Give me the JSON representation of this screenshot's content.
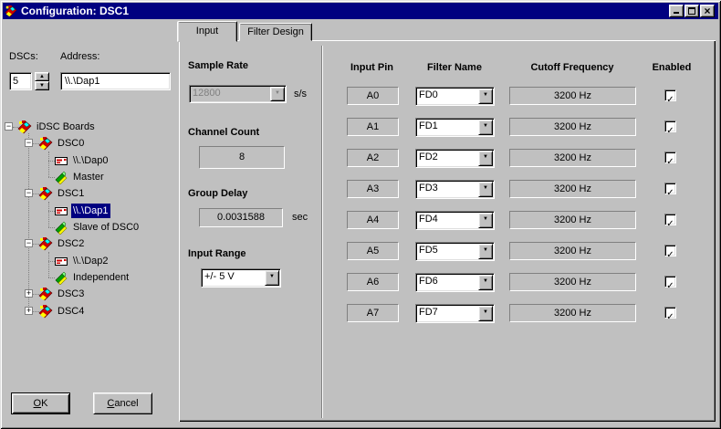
{
  "window": {
    "title": "Configuration: DSC1"
  },
  "icons": {
    "dropdown_arrow": "▼",
    "spinner_up": "▲",
    "spinner_down": "▼",
    "checkbox_check": "✓",
    "expander_expanded": "−",
    "expander_collapsed": "+",
    "close": "×"
  },
  "left_panel": {
    "dscs_label": "DSCs:",
    "dscs_value": "5",
    "address_label": "Address:",
    "address_value": "\\\\.\\Dap1"
  },
  "tree": {
    "items": [
      {
        "label": "iDSC Boards",
        "level": 0,
        "expander": "expanded",
        "icon": "board-icon",
        "selected": false
      },
      {
        "label": "DSC0",
        "level": 1,
        "expander": "expanded",
        "icon": "board-icon",
        "selected": false
      },
      {
        "label": "\\\\.\\Dap0",
        "level": 2,
        "expander": "none",
        "icon": "dap-icon",
        "selected": false
      },
      {
        "label": "Master",
        "level": 2,
        "expander": "none",
        "icon": "mode-icon",
        "selected": false
      },
      {
        "label": "DSC1",
        "level": 1,
        "expander": "expanded",
        "icon": "board-icon",
        "selected": false
      },
      {
        "label": "\\\\.\\Dap1",
        "level": 2,
        "expander": "none",
        "icon": "dap-icon",
        "selected": true
      },
      {
        "label": "Slave of DSC0",
        "level": 2,
        "expander": "none",
        "icon": "mode-icon",
        "selected": false
      },
      {
        "label": "DSC2",
        "level": 1,
        "expander": "expanded",
        "icon": "board-icon",
        "selected": false
      },
      {
        "label": "\\\\.\\Dap2",
        "level": 2,
        "expander": "none",
        "icon": "dap-icon",
        "selected": false
      },
      {
        "label": "Independent",
        "level": 2,
        "expander": "none",
        "icon": "mode-icon",
        "selected": false
      },
      {
        "label": "DSC3",
        "level": 1,
        "expander": "collapsed",
        "icon": "board-icon",
        "selected": false
      },
      {
        "label": "DSC4",
        "level": 1,
        "expander": "collapsed",
        "icon": "board-icon",
        "selected": false
      }
    ]
  },
  "buttons": {
    "ok": {
      "first": "O",
      "rest": "K"
    },
    "cancel": {
      "first": "C",
      "rest": "ancel"
    }
  },
  "tabs": [
    {
      "label": "Input",
      "active": true
    },
    {
      "label": "Filter Design",
      "active": false
    }
  ],
  "settings": {
    "sample_rate": {
      "label": "Sample Rate",
      "value": "12800",
      "unit": "s/s",
      "enabled": false
    },
    "channel_count": {
      "label": "Channel Count",
      "value": "8"
    },
    "group_delay": {
      "label": "Group Delay",
      "value": "0.0031588",
      "unit": "sec"
    },
    "input_range": {
      "label": "Input Range",
      "value": "+/- 5 V"
    }
  },
  "channel_table": {
    "headers": {
      "pin": "Input Pin",
      "filter": "Filter Name",
      "cutoff": "Cutoff Frequency",
      "enabled": "Enabled"
    },
    "rows": [
      {
        "pin": "A0",
        "filter": "FD0",
        "cutoff": "3200 Hz",
        "enabled": true
      },
      {
        "pin": "A1",
        "filter": "FD1",
        "cutoff": "3200 Hz",
        "enabled": true
      },
      {
        "pin": "A2",
        "filter": "FD2",
        "cutoff": "3200 Hz",
        "enabled": true
      },
      {
        "pin": "A3",
        "filter": "FD3",
        "cutoff": "3200 Hz",
        "enabled": true
      },
      {
        "pin": "A4",
        "filter": "FD4",
        "cutoff": "3200 Hz",
        "enabled": true
      },
      {
        "pin": "A5",
        "filter": "FD5",
        "cutoff": "3200 Hz",
        "enabled": true
      },
      {
        "pin": "A6",
        "filter": "FD6",
        "cutoff": "3200 Hz",
        "enabled": true
      },
      {
        "pin": "A7",
        "filter": "FD7",
        "cutoff": "3200 Hz",
        "enabled": true
      }
    ]
  }
}
